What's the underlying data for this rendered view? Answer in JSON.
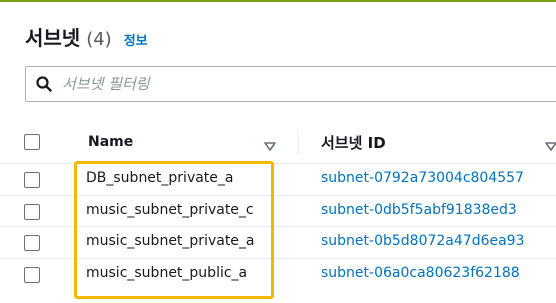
{
  "header": {
    "title": "서브넷",
    "count": "(4)",
    "info_link": "정보"
  },
  "filter": {
    "placeholder": "서브넷 필터링",
    "icon": "search-icon"
  },
  "table": {
    "columns": [
      {
        "label": "Name",
        "sortable": true
      },
      {
        "label": "서브넷 ID",
        "sortable": true
      }
    ],
    "rows": [
      {
        "name": "DB_subnet_private_a",
        "subnet_id": "subnet-0792a73004c804557"
      },
      {
        "name": "music_subnet_private_c",
        "subnet_id": "subnet-0db5f5abf91838ed3"
      },
      {
        "name": "music_subnet_private_a",
        "subnet_id": "subnet-0b5d8072a47d6ea93"
      },
      {
        "name": "music_subnet_public_a",
        "subnet_id": "subnet-06a0ca80623f62188"
      }
    ]
  },
  "colors": {
    "accent_link": "#0073bb",
    "highlight_border": "#f5b800",
    "top_border": "#7aa116"
  }
}
